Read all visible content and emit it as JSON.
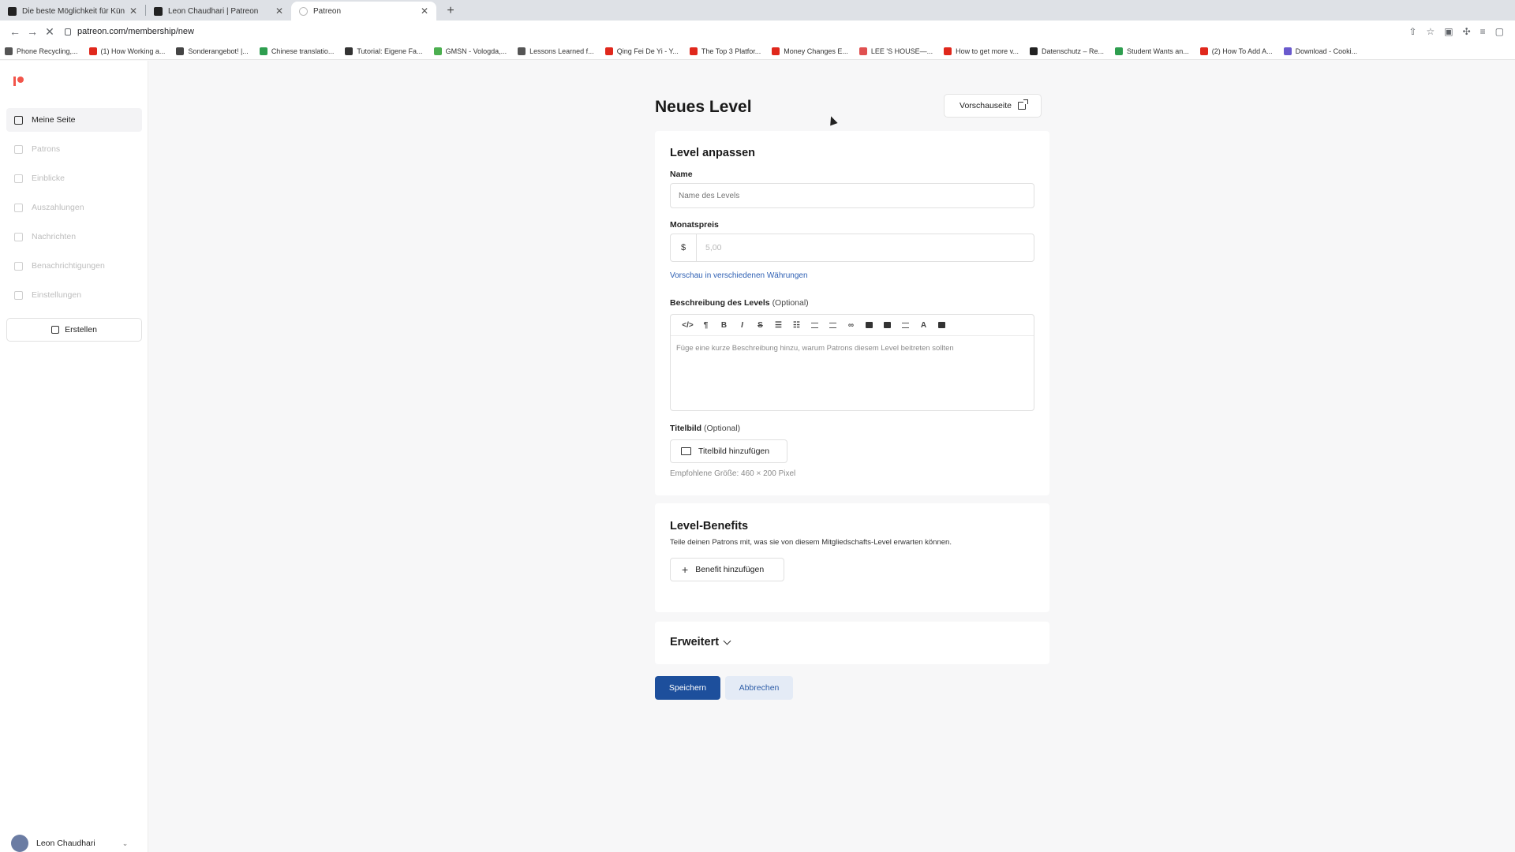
{
  "browser": {
    "tabs": [
      {
        "title": "Die beste Möglichkeit für Küns"
      },
      {
        "title": "Leon Chaudhari | Patreon"
      },
      {
        "title": "Patreon"
      }
    ],
    "url": "patreon.com/membership/new",
    "bookmarks": [
      {
        "label": "Phone Recycling,...",
        "color": "#555555"
      },
      {
        "label": "(1) How Working a...",
        "color": "#e0281c"
      },
      {
        "label": "Sonderangebot! |...",
        "color": "#444444"
      },
      {
        "label": "Chinese translatio...",
        "color": "#2e9e4f"
      },
      {
        "label": "Tutorial: Eigene Fa...",
        "color": "#333333"
      },
      {
        "label": "GMSN - Vologda,...",
        "color": "#4caf50"
      },
      {
        "label": "Lessons Learned f...",
        "color": "#555555"
      },
      {
        "label": "Qing Fei De Yi - Y...",
        "color": "#e0281c"
      },
      {
        "label": "The Top 3 Platfor...",
        "color": "#e0281c"
      },
      {
        "label": "Money Changes E...",
        "color": "#e0281c"
      },
      {
        "label": "LEE 'S HOUSE—...",
        "color": "#e05050"
      },
      {
        "label": "How to get more v...",
        "color": "#e0281c"
      },
      {
        "label": "Datenschutz – Re...",
        "color": "#222222"
      },
      {
        "label": "Student Wants an...",
        "color": "#2e9e4f"
      },
      {
        "label": "(2) How To Add A...",
        "color": "#e0281c"
      },
      {
        "label": "Download - Cooki...",
        "color": "#6a5acd"
      }
    ]
  },
  "sidebar": {
    "items": [
      {
        "label": "Meine Seite",
        "icon": "home-icon"
      },
      {
        "label": "Patrons",
        "icon": "users-icon"
      },
      {
        "label": "Einblicke",
        "icon": "chart-icon"
      },
      {
        "label": "Auszahlungen",
        "icon": "wallet-icon"
      },
      {
        "label": "Nachrichten",
        "icon": "mail-icon"
      },
      {
        "label": "Benachrichtigungen",
        "icon": "bell-icon"
      },
      {
        "label": "Einstellungen",
        "icon": "gear-icon"
      }
    ],
    "create_label": "Erstellen",
    "user_name": "Leon Chaudhari"
  },
  "main": {
    "title": "Neues Level",
    "preview_label": "Vorschauseite",
    "customize": {
      "title": "Level anpassen",
      "name_label": "Name",
      "name_placeholder": "Name des Levels",
      "price_label": "Monatspreis",
      "currency": "$",
      "price_placeholder": "5,00",
      "currency_link": "Vorschau in verschiedenen Währungen",
      "desc_label": "Beschreibung des Levels",
      "optional": "(Optional)",
      "desc_placeholder": "Füge eine kurze Beschreibung hinzu, warum Patrons diesem Level beitreten sollten",
      "image_label": "Titelbild",
      "image_button": "Titelbild hinzufügen",
      "image_hint": "Empfohlene Größe: 460 × 200 Pixel"
    },
    "benefits": {
      "title": "Level-Benefits",
      "description": "Teile deinen Patrons mit, was sie von diesem Mitgliedschafts-Level erwarten können.",
      "add_button": "Benefit hinzufügen"
    },
    "advanced_label": "Erweitert",
    "save_label": "Speichern",
    "cancel_label": "Abbrechen"
  }
}
